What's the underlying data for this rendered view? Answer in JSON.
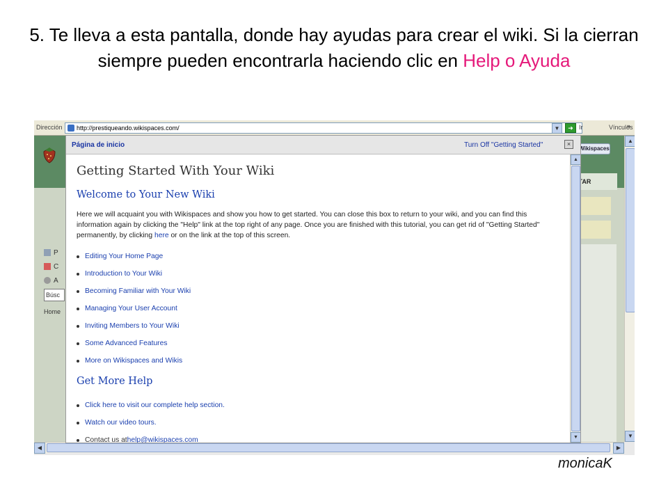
{
  "slide": {
    "title_main": "5. Te lleva a esta pantalla, donde hay ayudas para crear el wiki. Si la cierran siempre pueden encontrarla haciendo clic en ",
    "title_highlight": "Help o Ayuda",
    "signature": "monicaK"
  },
  "browser": {
    "address_label": "Dirección",
    "url": "http://prestiqueando.wikispaces.com/",
    "go_label": "Ir",
    "links_label": "Vínculos",
    "more": "»"
  },
  "wiki": {
    "wikispaces_button": "Wikispaces",
    "tab_label": "ITAR",
    "left_items": [
      "P",
      "C",
      "A"
    ],
    "search_label": "Búsc",
    "home_label": "Home"
  },
  "dialog": {
    "title": "Página de inicio",
    "turn_off": "Turn Off \"Getting Started\"",
    "close": "×",
    "heading": "Getting Started With Your Wiki",
    "welcome": "Welcome to Your New Wiki",
    "intro_before_link": "Here we will acquaint you with Wikispaces and show you how to get started. You can close this box to return to your wiki, and you can find this information again by clicking the \"Help\" link at the top right of any page. Once you are finished with this tutorial, you can get rid of \"Getting Started\" permanently, by clicking ",
    "intro_link": "here",
    "intro_after_link": " or on the link at the top of this screen.",
    "topics": [
      "Editing Your Home Page",
      "Introduction to Your Wiki",
      "Becoming Familiar with Your Wiki",
      "Managing Your User Account",
      "Inviting Members to Your Wiki",
      "Some Advanced Features",
      "More on Wikispaces and Wikis"
    ],
    "more_help_heading": "Get More Help",
    "help_links": [
      "Click here to visit our complete help section.",
      "Watch our video tours."
    ],
    "contact_text": "Contact us at ",
    "contact_email": "help@wikispaces.com"
  },
  "colors": {
    "highlight": "#e5197a",
    "wiki_header": "#5c8a63",
    "link": "#1a3fae"
  }
}
